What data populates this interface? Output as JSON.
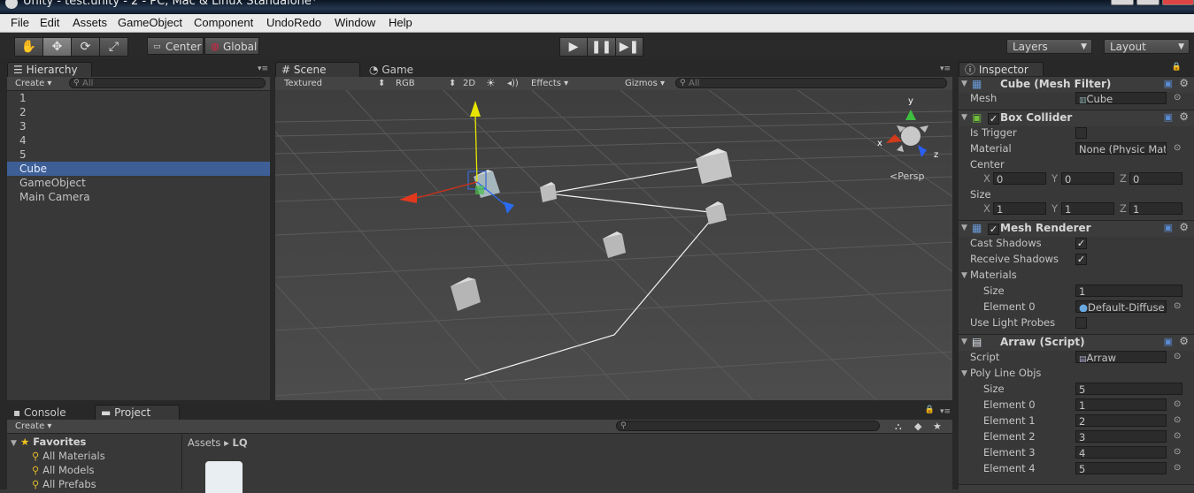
{
  "window": {
    "title": "Unity - test.unity - 2 - PC, Mac & Linux Standalone*"
  },
  "menu": [
    "File",
    "Edit",
    "Assets",
    "GameObject",
    "Component",
    "UndoRedo",
    "Window",
    "Help"
  ],
  "toolbar": {
    "pivot_label": "Center",
    "space_label": "Global",
    "layers_label": "Layers",
    "layout_label": "Layout"
  },
  "hierarchy": {
    "tab": "Hierarchy",
    "create_label": "Create",
    "search_placeholder": "All",
    "items": [
      "1",
      "2",
      "3",
      "4",
      "5",
      "Cube",
      "GameObject",
      "Main Camera"
    ],
    "selected": "Cube"
  },
  "scene": {
    "tab_scene": "Scene",
    "tab_game": "Game",
    "shading": "Textured",
    "render_mode": "RGB",
    "mode_2d": "2D",
    "effects_label": "Effects",
    "gizmos_label": "Gizmos",
    "search_placeholder": "All",
    "gizmo_x": "x",
    "gizmo_y": "y",
    "gizmo_z": "z",
    "persp_label": "Persp"
  },
  "inspector": {
    "tab": "Inspector",
    "mesh_filter": {
      "title": "Cube (Mesh Filter)",
      "mesh_label": "Mesh",
      "mesh_value": "Cube"
    },
    "box_collider": {
      "title": "Box Collider",
      "is_trigger_label": "Is Trigger",
      "material_label": "Material",
      "material_value": "None (Physic Mate",
      "center_label": "Center",
      "size_label": "Size",
      "center": {
        "x": "0",
        "y": "0",
        "z": "0"
      },
      "size": {
        "x": "1",
        "y": "1",
        "z": "1"
      },
      "axis_x": "X",
      "axis_y": "Y",
      "axis_z": "Z"
    },
    "mesh_renderer": {
      "title": "Mesh Renderer",
      "cast_shadows_label": "Cast Shadows",
      "receive_shadows_label": "Receive Shadows",
      "materials_label": "Materials",
      "size_label": "Size",
      "size_value": "1",
      "element0_label": "Element 0",
      "element0_value": "Default-Diffuse",
      "use_light_probes_label": "Use Light Probes"
    },
    "script": {
      "title": "Arraw (Script)",
      "script_label": "Script",
      "script_value": "Arraw",
      "poly_label": "Poly Line Objs",
      "size_label": "Size",
      "size_value": "5",
      "elements": [
        {
          "label": "Element 0",
          "value": "1"
        },
        {
          "label": "Element 1",
          "value": "2"
        },
        {
          "label": "Element 2",
          "value": "3"
        },
        {
          "label": "Element 3",
          "value": "4"
        },
        {
          "label": "Element 4",
          "value": "5"
        }
      ]
    }
  },
  "bottom": {
    "tab_console": "Console",
    "tab_project": "Project",
    "create_label": "Create",
    "favorites_label": "Favorites",
    "favorites": [
      "All Materials",
      "All Models",
      "All Prefabs"
    ],
    "breadcrumb_root": "Assets",
    "breadcrumb_sep": "▸",
    "breadcrumb_leaf": "LQ"
  }
}
